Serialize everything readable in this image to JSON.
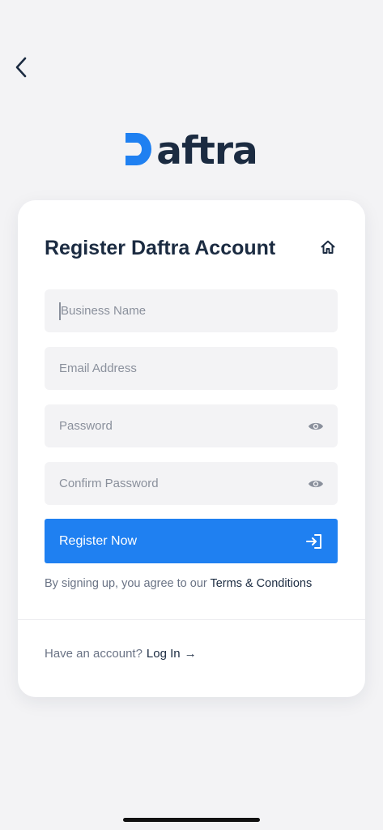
{
  "header": {
    "back_icon": "chevron-left-icon"
  },
  "logo": {
    "text": "aftra",
    "brand_color": "#1f80f1",
    "text_color": "#1b2b41"
  },
  "card": {
    "title": "Register Daftra Account",
    "home_icon": "home-icon",
    "fields": {
      "business_name": {
        "placeholder": "Business Name",
        "value": ""
      },
      "email": {
        "placeholder": "Email Address",
        "value": ""
      },
      "password": {
        "placeholder": "Password",
        "value": "",
        "toggle_icon": "eye-icon"
      },
      "confirm_password": {
        "placeholder": "Confirm Password",
        "value": "",
        "toggle_icon": "eye-icon"
      }
    },
    "register_button": {
      "label": "Register Now",
      "icon": "sign-in-icon",
      "color": "#1f80f1"
    },
    "terms": {
      "prefix": "By signing up, you agree to our ",
      "link": "Terms & Conditions"
    },
    "login": {
      "prompt": "Have an account?",
      "link": "Log In",
      "arrow": "→"
    }
  }
}
